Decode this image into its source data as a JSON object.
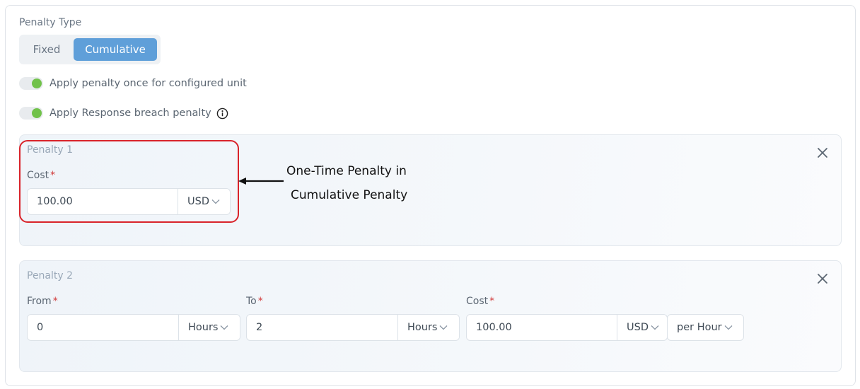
{
  "penalty_type": {
    "label": "Penalty Type",
    "options": [
      "Fixed",
      "Cumulative"
    ],
    "selected": "Cumulative"
  },
  "toggles": [
    {
      "label": "Apply penalty once for configured unit",
      "on": true
    },
    {
      "label": "Apply Response breach penalty",
      "on": true,
      "info_icon": "info-icon"
    }
  ],
  "penalty1": {
    "title": "Penalty 1",
    "cost_label": "Cost",
    "required_mark": "*",
    "cost_value": "100.00",
    "currency": "USD"
  },
  "penalty2": {
    "title": "Penalty 2",
    "from_label": "From",
    "to_label": "To",
    "cost_label": "Cost",
    "required_mark": "*",
    "from_value": "0",
    "from_unit": "Hours",
    "to_value": "2",
    "to_unit": "Hours",
    "cost_value": "100.00",
    "currency": "USD",
    "rate": "per Hour"
  },
  "annotation": {
    "line1": "One-Time Penalty in",
    "line2": "Cumulative Penalty"
  },
  "colors": {
    "accent": "#5f9fd9",
    "toggle_on": "#71c24a",
    "required": "#d23b3b",
    "highlight": "#d9232a"
  }
}
